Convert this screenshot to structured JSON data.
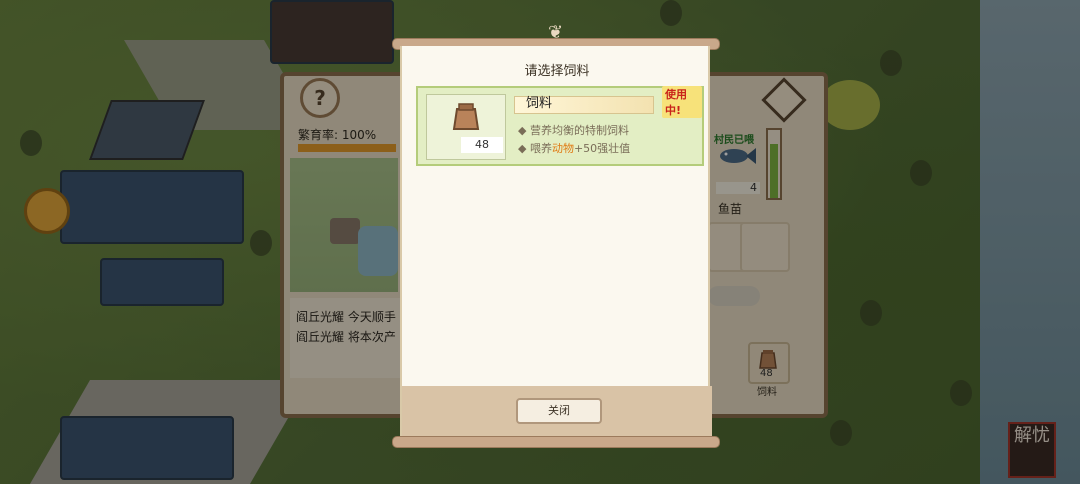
{
  "modal": {
    "title": "请选择饲料",
    "close_label": "关闭"
  },
  "feed_item": {
    "name": "饲料",
    "count": "48",
    "desc_line1": "营养均衡的特制饲料",
    "desc_line2_prefix": "喂养",
    "desc_line2_highlight": "动物",
    "desc_line2_suffix": "+50强壮值",
    "in_use_badge": "使用中!",
    "icon": "feed-sack-icon"
  },
  "background_panel": {
    "breeding_rate_label": "繁育率: 100%",
    "log_lines": [
      "阎丘光耀 今天顺手",
      "阎丘光耀 将本次产"
    ],
    "villager_tag": "村民已喂",
    "fish_count": "4",
    "fish_label": "鱼苗",
    "feed_slot_count": "48",
    "feed_slot_label": "饲料",
    "help_button": "?",
    "progress_fraction": 0.8
  },
  "colors": {
    "accent_orange": "#e07b14",
    "selected_card": "#e3eec4",
    "in_use_red": "#c9241a"
  },
  "seal": {
    "text": "解忧"
  }
}
